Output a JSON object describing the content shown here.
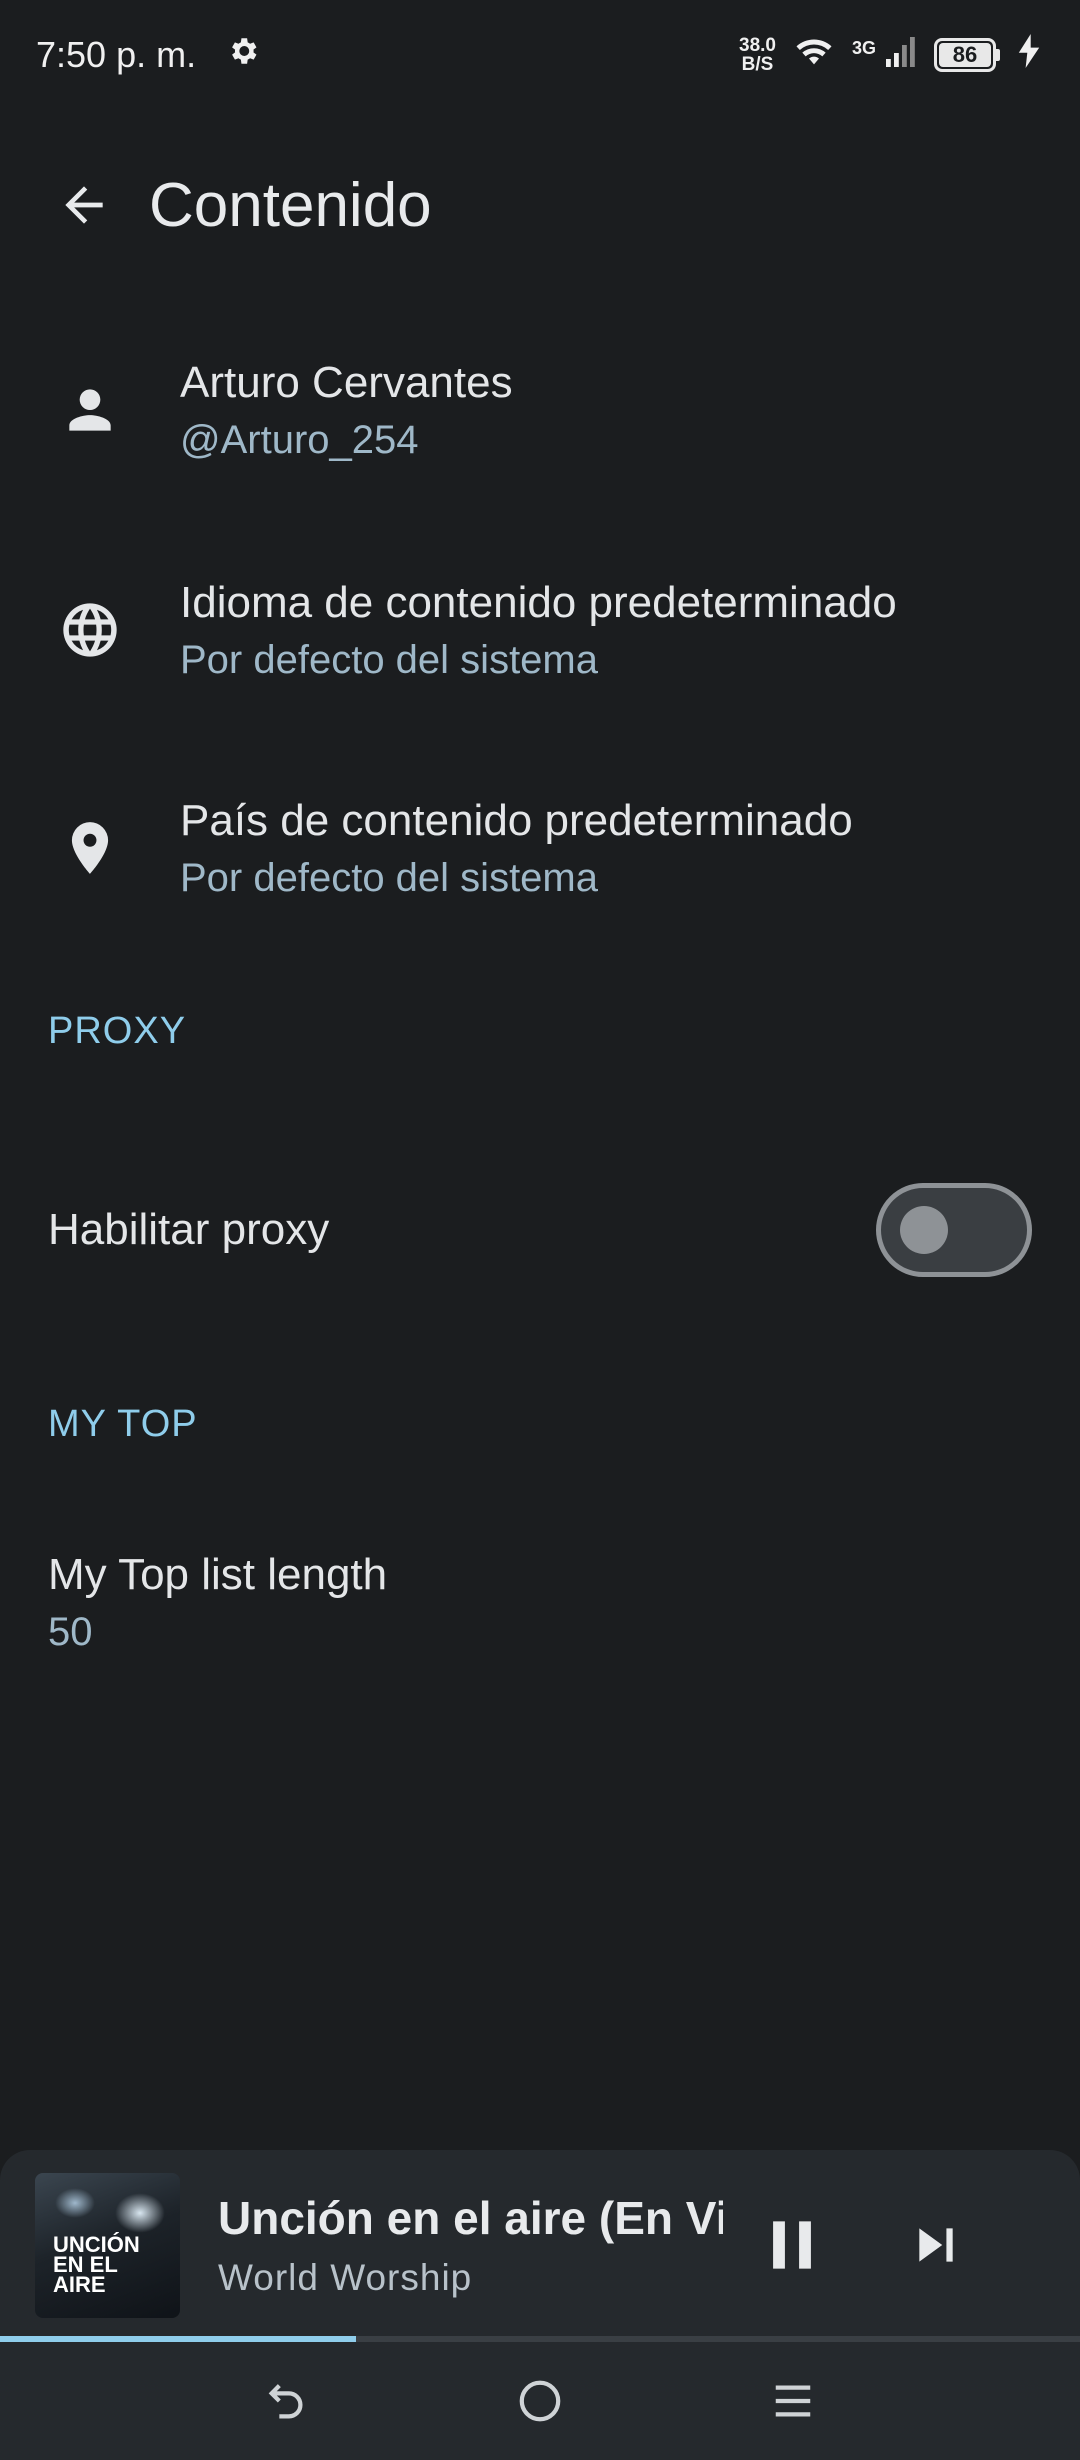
{
  "status_bar": {
    "time": "7:50 p. m.",
    "speed_value": "38.0",
    "speed_unit": "B/S",
    "network_type": "3G",
    "battery": "86"
  },
  "app_bar": {
    "title": "Contenido"
  },
  "account": {
    "name": "Arturo Cervantes",
    "handle": "@Arturo_254"
  },
  "language": {
    "title": "Idioma de contenido predeterminado",
    "value": "Por defecto del sistema"
  },
  "country": {
    "title": "País de contenido predeterminado",
    "value": "Por defecto del sistema"
  },
  "proxy_section": {
    "header": "PROXY",
    "enable_label": "Habilitar proxy",
    "enabled": false
  },
  "my_top_section": {
    "header": "MY TOP",
    "length_label": "My Top list length",
    "length_value": "50"
  },
  "mini_player": {
    "song_title": "Unción en el aire (En Vivo)",
    "artist": "World Worship",
    "art_text": "UNCIÓN EN EL AIRE",
    "progress": 0.33
  },
  "colors": {
    "background": "#1b1d1f",
    "accent": "#8fcdeb",
    "subtitle": "#9fb8c8"
  }
}
